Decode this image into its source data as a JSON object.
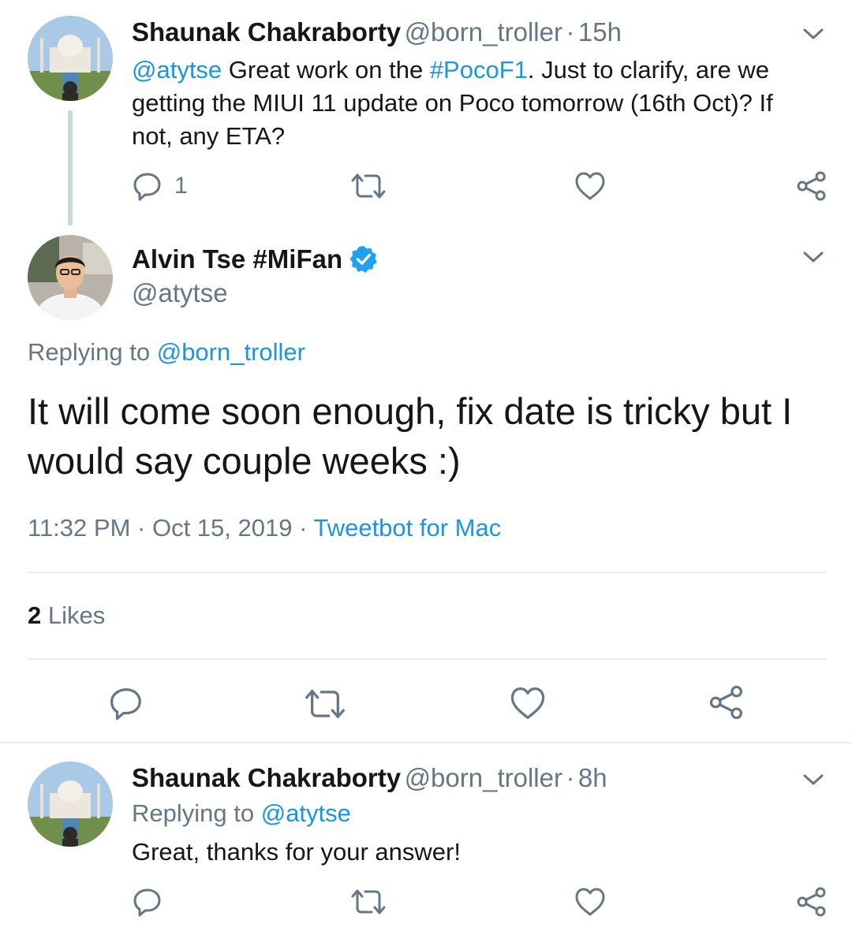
{
  "tweet1": {
    "name": "Shaunak Chakraborty",
    "handle": "@born_troller",
    "sep": "·",
    "time": "15h",
    "text_mention": "@atytse",
    "text_a": " Great work on the ",
    "text_hashtag": "#PocoF1",
    "text_b": ". Just to clarify, are we getting the MIUI 11 update on Poco tomorrow (16th Oct)? If not, any ETA?",
    "reply_count": "1"
  },
  "main": {
    "name": "Alvin Tse #MiFan",
    "handle": "@atytse",
    "replying_prefix": "Replying to ",
    "replying_handle": "@born_troller",
    "text": "It will come soon enough, fix date is tricky but I would say couple weeks :)",
    "time": "11:32 PM",
    "sep1": " · ",
    "date": "Oct 15, 2019",
    "sep2": " · ",
    "source": "Tweetbot for Mac",
    "likes_count": "2",
    "likes_label": " Likes"
  },
  "tweet3": {
    "name": "Shaunak Chakraborty",
    "handle": "@born_troller",
    "sep": "·",
    "time": "8h",
    "replying_prefix": "Replying to ",
    "replying_handle": "@atytse",
    "text": "Great, thanks for your answer!"
  },
  "colors": {
    "link": "#1b95e0",
    "secondary": "#657786",
    "verified": "#1da1f2",
    "icon": "#657786"
  },
  "icons": [
    "chevron-down-icon",
    "reply-icon",
    "retweet-icon",
    "like-icon",
    "share-icon",
    "verified-badge-icon"
  ]
}
